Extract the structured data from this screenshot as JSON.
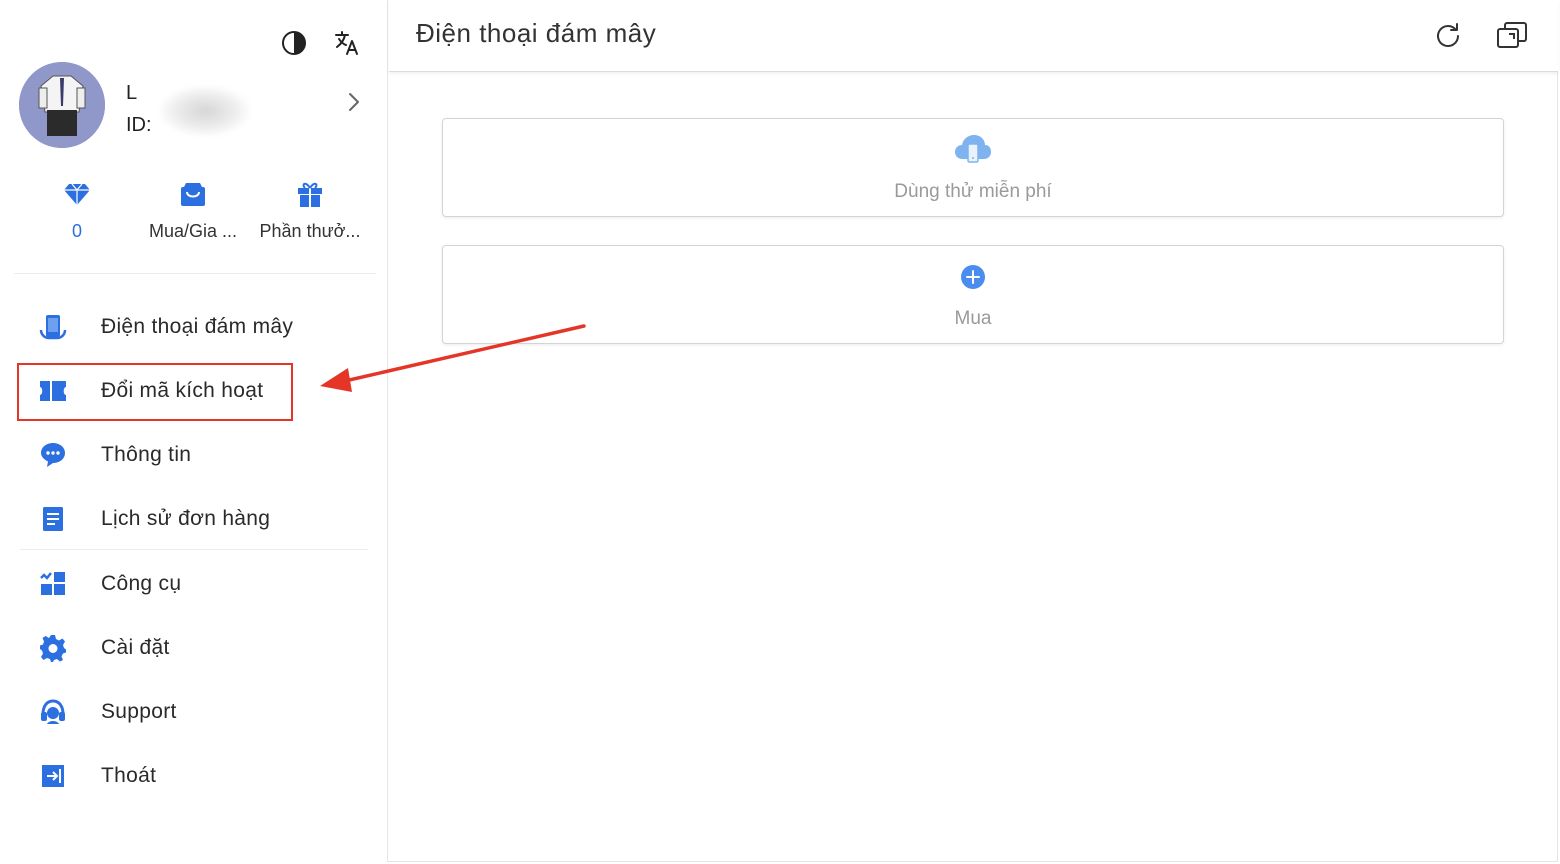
{
  "sidebar": {
    "user": {
      "name": "L",
      "id_label": "ID:"
    },
    "stats": [
      {
        "icon": "diamond-icon",
        "label": "0"
      },
      {
        "icon": "shopping-bag-icon",
        "label": "Mua/Gia ..."
      },
      {
        "icon": "gift-icon",
        "label": "Phần thưở..."
      }
    ],
    "nav": [
      {
        "icon": "cloud-phone-icon",
        "label": "Điện thoại đám mây"
      },
      {
        "icon": "ticket-icon",
        "label": "Đổi mã kích hoạt"
      },
      {
        "icon": "message-icon",
        "label": "Thông tin"
      },
      {
        "icon": "document-icon",
        "label": "Lịch sử đơn hàng"
      },
      {
        "icon": "tools-icon",
        "label": "Công cụ"
      },
      {
        "icon": "gear-icon",
        "label": "Cài đặt"
      },
      {
        "icon": "headset-icon",
        "label": "Support"
      },
      {
        "icon": "logout-icon",
        "label": "Thoát"
      }
    ]
  },
  "header": {
    "title": "Điện thoại đám mây"
  },
  "cards": [
    {
      "icon": "cloud-phone-icon",
      "label": "Dùng thử miễn phí"
    },
    {
      "icon": "plus-circle-icon",
      "label": "Mua"
    }
  ],
  "colors": {
    "accent": "#2c6fe0",
    "highlight": "#e53526",
    "muted": "#9a9a9a"
  }
}
